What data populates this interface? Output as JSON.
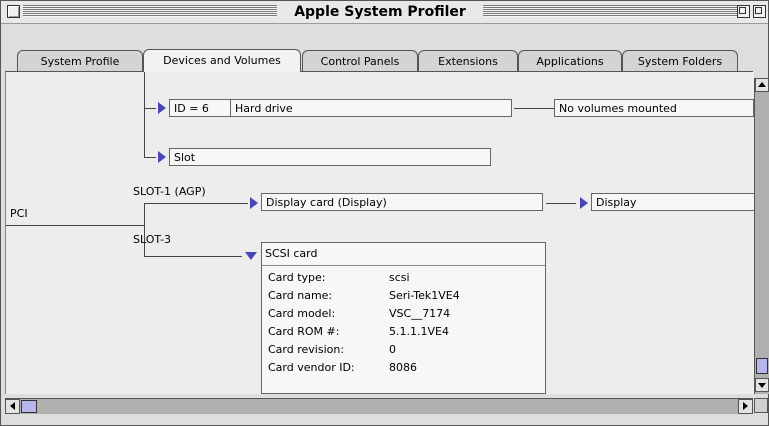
{
  "window": {
    "title": "Apple System Profiler"
  },
  "tabs": [
    {
      "label": "System Profile"
    },
    {
      "label": "Devices and Volumes",
      "active": true
    },
    {
      "label": "Control Panels"
    },
    {
      "label": "Extensions"
    },
    {
      "label": "Applications"
    },
    {
      "label": "System Folders"
    }
  ],
  "tree": {
    "hard_drive": {
      "id_label": "ID = 6",
      "name": "Hard drive",
      "volumes": "No volumes mounted"
    },
    "slot_item": {
      "name": "Slot"
    },
    "bus": {
      "label": "PCI"
    },
    "slot1": {
      "label": "SLOT-1 (AGP)",
      "card": "Display card (Display)",
      "child": "Display"
    },
    "slot3": {
      "label": "SLOT-3",
      "card": "SCSI card",
      "properties": [
        {
          "name": "Card type:",
          "value": "scsi"
        },
        {
          "name": "Card name:",
          "value": "Seri-Tek1VE4"
        },
        {
          "name": "Card model:",
          "value": "VSC__7174"
        },
        {
          "name": "Card ROM #:",
          "value": "5.1.1.1VE4"
        },
        {
          "name": "Card revision:",
          "value": "0"
        },
        {
          "name": "Card vendor ID:",
          "value": "8086"
        }
      ]
    }
  },
  "colors": {
    "disclosure_triangle": "#4a46b6",
    "scroll_thumb": "#b6b6ec"
  }
}
